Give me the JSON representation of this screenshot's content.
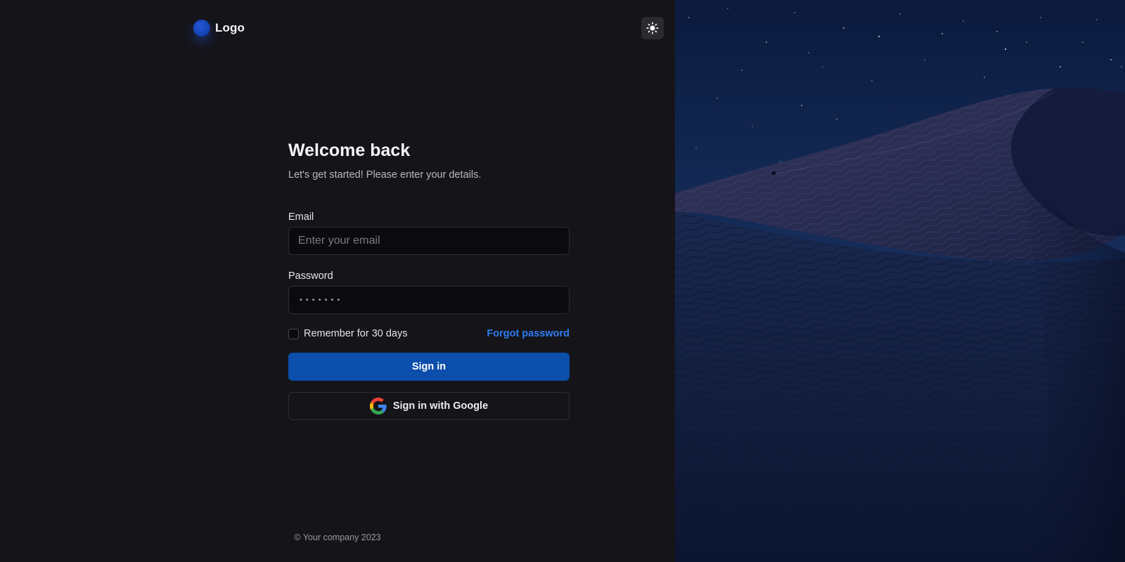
{
  "brand": {
    "logo_text": "Logo",
    "accent_color": "#0b4eab"
  },
  "header": {
    "theme_toggle_icon": "sun-icon"
  },
  "login": {
    "title": "Welcome back",
    "subtitle": "Let's get started! Please enter your details.",
    "email": {
      "label": "Email",
      "placeholder": "Enter your email",
      "value": ""
    },
    "password": {
      "label": "Password",
      "masked_value": "•••••••"
    },
    "remember": {
      "label": "Remember for 30 days",
      "checked": false
    },
    "forgot_label": "Forgot password",
    "sign_in_label": "Sign in",
    "google_label": "Sign in with Google"
  },
  "footer": {
    "copyright": "© Your company 2023"
  },
  "side_image": {
    "icon": "night-desert-dunes-image"
  }
}
